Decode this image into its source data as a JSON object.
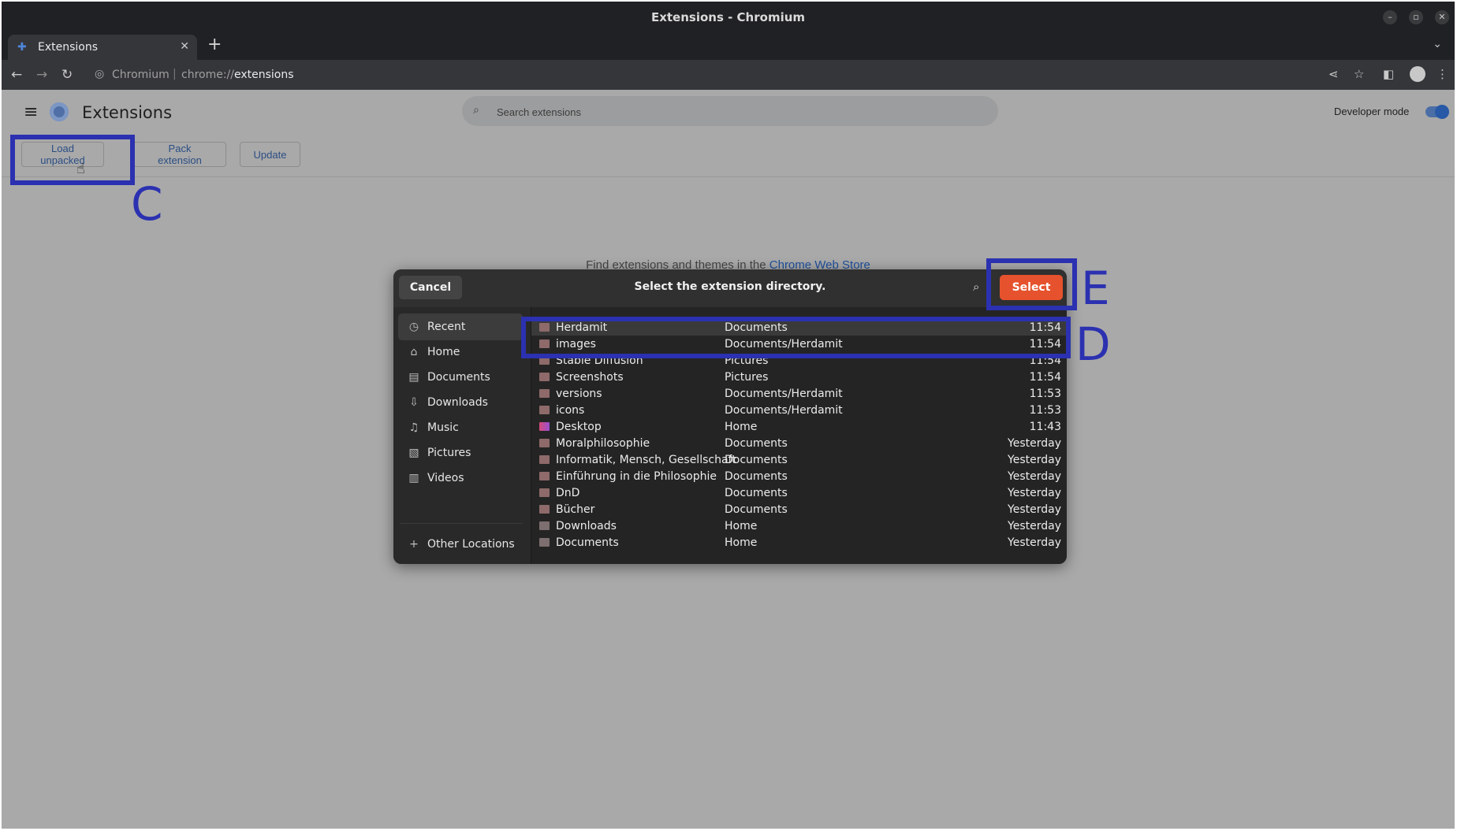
{
  "window": {
    "title": "Extensions - Chromium"
  },
  "tabs": [
    {
      "label": "Extensions",
      "icon": "puzzle-icon"
    }
  ],
  "address_bar": {
    "site": "Chromium",
    "url_prefix": "chrome://",
    "url_host": "extensions"
  },
  "page": {
    "title": "Extensions",
    "search_placeholder": "Search extensions",
    "developer_mode_label": "Developer mode",
    "developer_mode_on": true,
    "buttons": {
      "load_unpacked": "Load unpacked",
      "pack_extension": "Pack extension",
      "update": "Update"
    },
    "store_text": "Find extensions and themes in the",
    "store_link": "Chrome Web Store"
  },
  "annotations": {
    "c": "C",
    "d": "D",
    "e": "E"
  },
  "dialog": {
    "title": "Select the extension directory.",
    "cancel_label": "Cancel",
    "select_label": "Select",
    "places": [
      {
        "label": "Recent",
        "icon": "clock-icon",
        "active": true
      },
      {
        "label": "Home",
        "icon": "home-icon"
      },
      {
        "label": "Documents",
        "icon": "document-icon"
      },
      {
        "label": "Downloads",
        "icon": "download-icon"
      },
      {
        "label": "Music",
        "icon": "music-icon"
      },
      {
        "label": "Pictures",
        "icon": "picture-icon"
      },
      {
        "label": "Videos",
        "icon": "video-icon"
      },
      {
        "label": "Other Locations",
        "icon": "plus-icon"
      }
    ],
    "files": [
      {
        "name": "Herdamit",
        "location": "Documents",
        "time": "11:54",
        "selected": true
      },
      {
        "name": "images",
        "location": "Documents/Herdamit",
        "time": "11:54"
      },
      {
        "name": "Stable Diffusion",
        "location": "Pictures",
        "time": "11:54"
      },
      {
        "name": "Screenshots",
        "location": "Pictures",
        "time": "11:54"
      },
      {
        "name": "versions",
        "location": "Documents/Herdamit",
        "time": "11:53"
      },
      {
        "name": "icons",
        "location": "Documents/Herdamit",
        "time": "11:53"
      },
      {
        "name": "Desktop",
        "location": "Home",
        "time": "11:43"
      },
      {
        "name": "Moralphilosophie",
        "location": "Documents",
        "time": "Yesterday"
      },
      {
        "name": "Informatik, Mensch, Gesellschaft",
        "location": "Documents",
        "time": "Yesterday"
      },
      {
        "name": "Einführung in die Philosophie",
        "location": "Documents",
        "time": "Yesterday"
      },
      {
        "name": "DnD",
        "location": "Documents",
        "time": "Yesterday"
      },
      {
        "name": "Bücher",
        "location": "Documents",
        "time": "Yesterday"
      },
      {
        "name": "Downloads",
        "location": "Home",
        "time": "Yesterday"
      },
      {
        "name": "Documents",
        "location": "Home",
        "time": "Yesterday"
      }
    ]
  },
  "colors": {
    "accent_select": "#e5522d",
    "annotation": "#2b31b0",
    "link": "#1e4f9c"
  }
}
